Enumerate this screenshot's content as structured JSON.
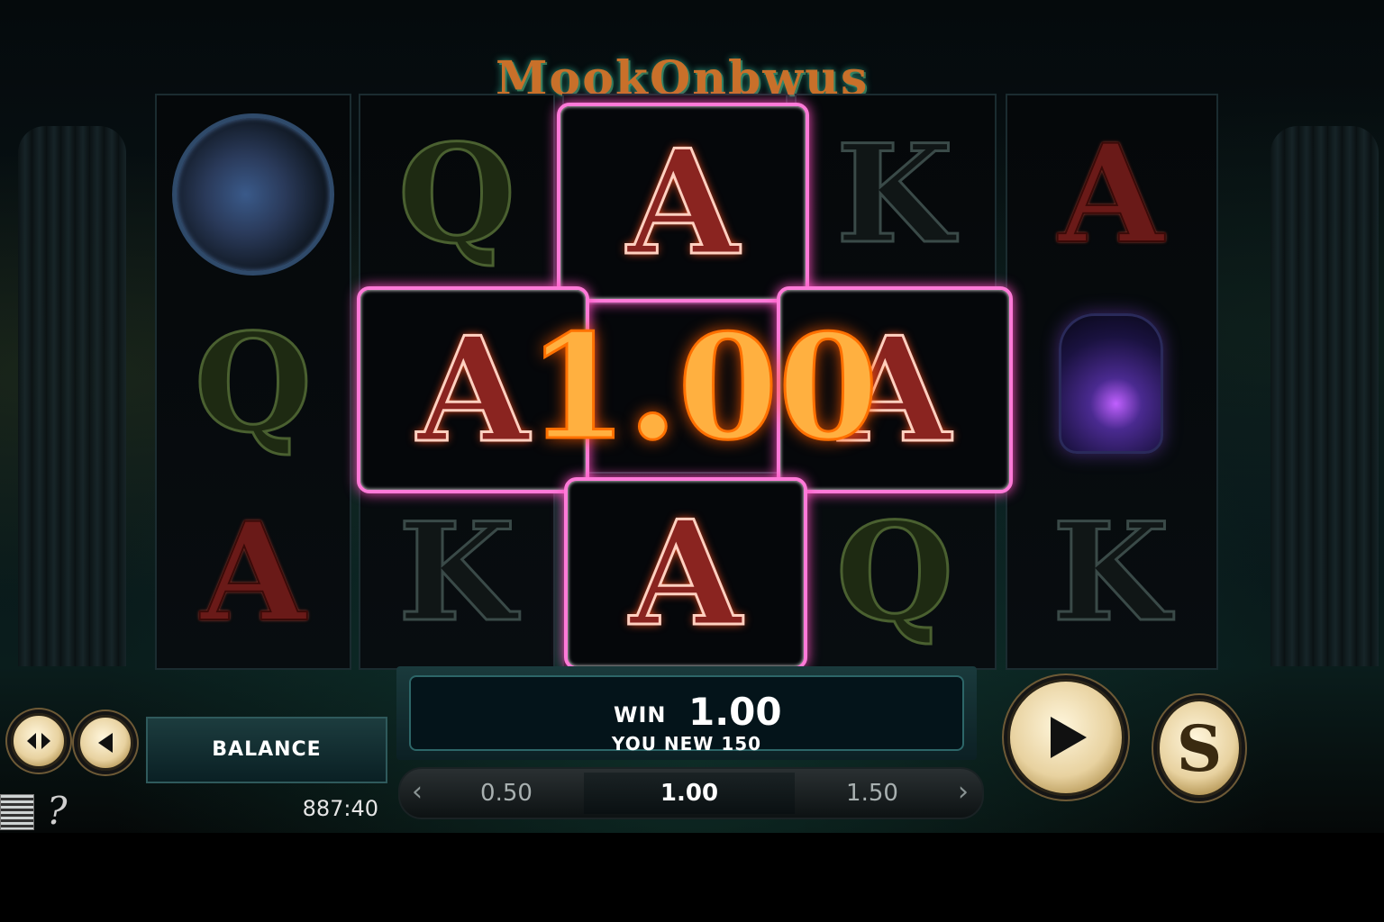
{
  "game": {
    "logo_text": "MookOnbwus"
  },
  "reels": {
    "reel1": [
      "orb",
      "Q",
      "A"
    ],
    "reel2": [
      "Q",
      "A",
      "K"
    ],
    "reel3": [
      "A",
      "",
      "A"
    ],
    "reel4": [
      "K",
      "A",
      "Q"
    ],
    "reel5": [
      "A",
      "lantern",
      "K"
    ]
  },
  "win_overlay": {
    "amount": "1.00",
    "symbol": "A"
  },
  "win_panel": {
    "label": "WIN",
    "value": "1.00",
    "sub": "YOU NEW 150"
  },
  "bet": {
    "prev_arrow": "‹",
    "next_arrow": "›",
    "options": [
      "0.50",
      "1.00",
      "1.50"
    ],
    "selected": "1.00"
  },
  "balance": {
    "label": "BALANCE",
    "value": "887:40"
  },
  "controls": {
    "spin_icon": "play-icon",
    "s_button_text": "S",
    "autoplay_icon": "double-arrow-icon",
    "back_icon": "left-arrow-icon",
    "help_text": "?"
  },
  "colors": {
    "win_glow": "#ff7ad8",
    "win_amount": "#ffb040",
    "button_gold": "#e8d2a0",
    "panel_teal": "#2d6668"
  }
}
